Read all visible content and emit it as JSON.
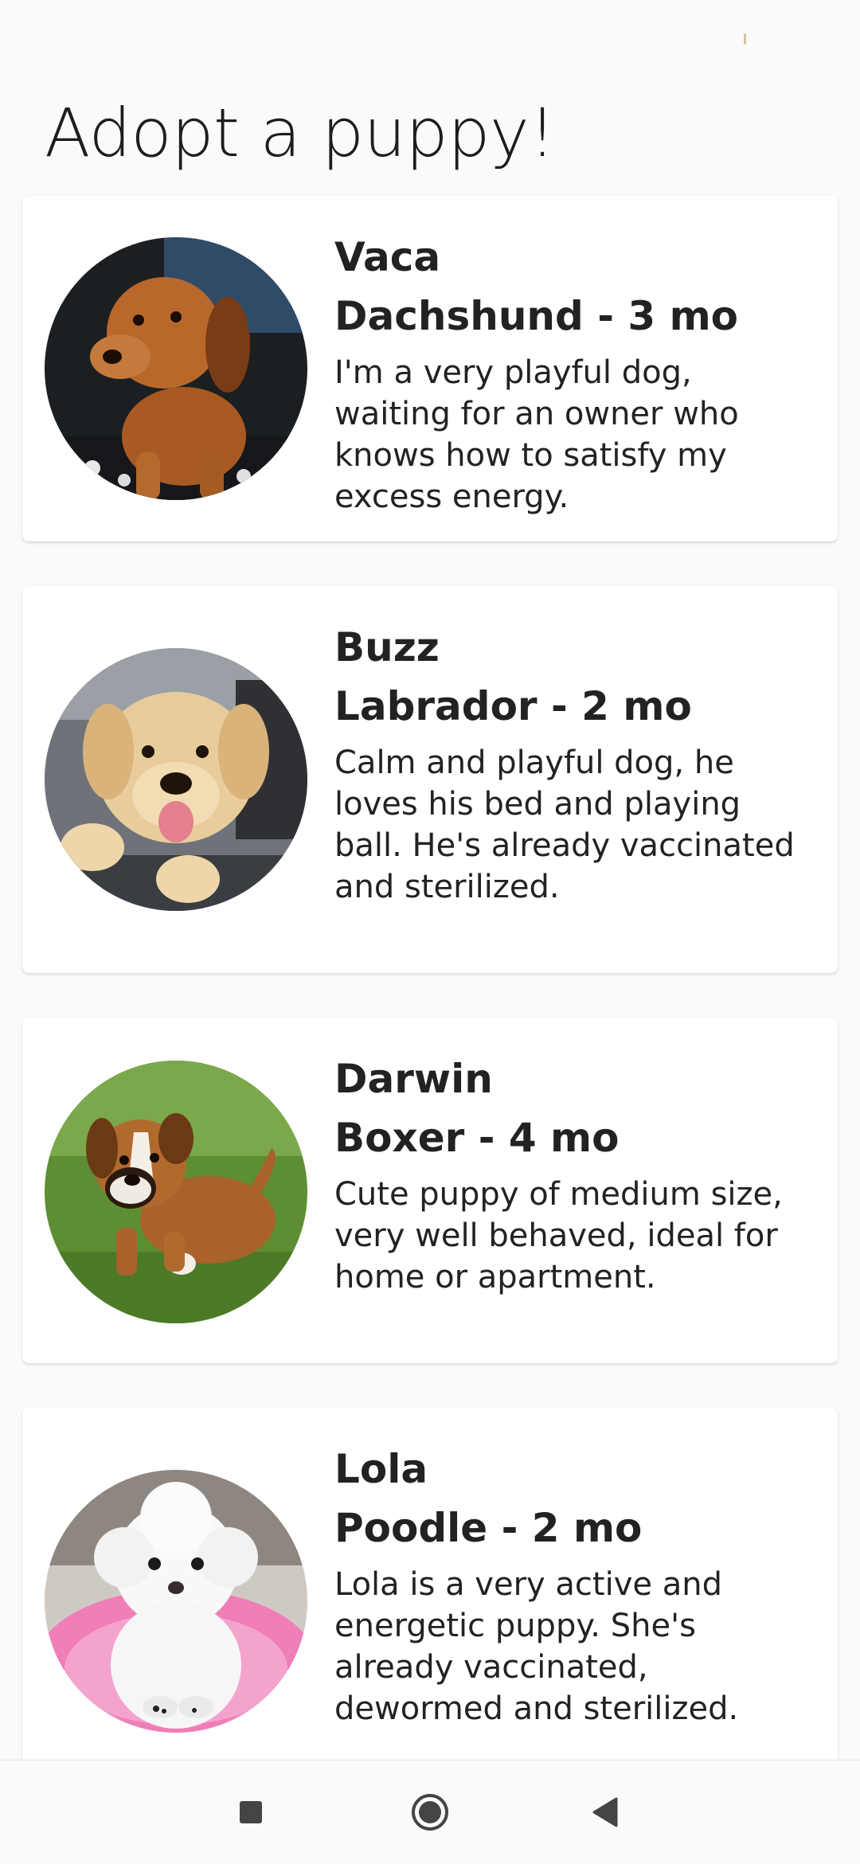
{
  "page": {
    "title": "Adopt a puppy!"
  },
  "puppies": [
    {
      "name": "Vaca",
      "breed_age": "Dachshund - 3 mo",
      "description": "I'm a very playful dog, waiting for an owner who knows how to satisfy my excess energy."
    },
    {
      "name": "Buzz",
      "breed_age": "Labrador - 2 mo",
      "description": "Calm and playful dog, he loves his bed and playing ball. He's already vaccinated and sterilized."
    },
    {
      "name": "Darwin",
      "breed_age": "Boxer - 4 mo",
      "description": "Cute puppy of medium size, very well behaved, ideal for home or apartment."
    },
    {
      "name": "Lola",
      "breed_age": "Poodle - 2 mo",
      "description": "Lola is a very active and energetic puppy. She's already vaccinated, dewormed and sterilized."
    }
  ],
  "nav": {
    "recents_icon": "square-icon",
    "home_icon": "circle-icon",
    "back_icon": "triangle-back-icon"
  }
}
